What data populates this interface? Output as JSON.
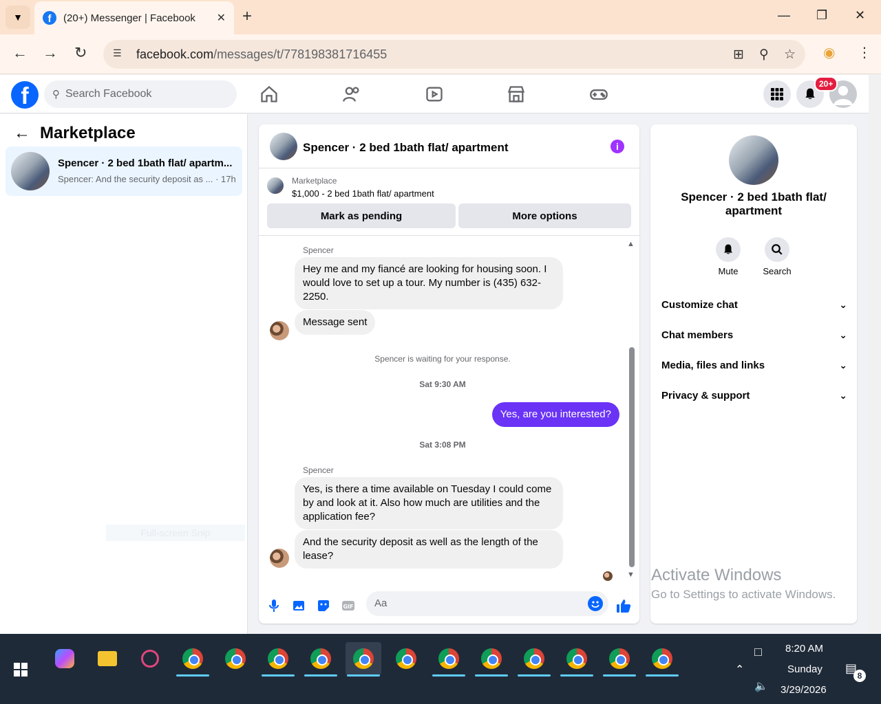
{
  "browser": {
    "tab_title": "(20+) Messenger | Facebook",
    "url_host": "facebook.com",
    "url_path": "/messages/t/778198381716455"
  },
  "fb": {
    "search_placeholder": "Search Facebook",
    "notif_badge": "20+"
  },
  "left": {
    "title": "Marketplace",
    "conversation": {
      "name": "Spencer · 2 bed 1bath flat/ apartm...",
      "preview": "Spencer: And the security deposit as ... · 17h"
    },
    "snip_label": "Full-screen Snip"
  },
  "chat": {
    "header_name": "Spencer · 2 bed 1bath flat/ apartment",
    "marketplace_label": "Marketplace",
    "listing": "$1,000 - 2 bed 1bath flat/ apartment",
    "mark_pending": "Mark as pending",
    "more_options": "More options",
    "messages": {
      "sender1": "Spencer",
      "m1": "Hey me and my fiancé are looking for housing soon.  I would love to set up a tour.  My number is (435) 632-2250.",
      "m2": "Message sent",
      "waiting": "Spencer is waiting for your response.",
      "time1": "Sat 9:30 AM",
      "out1": "Yes, are you interested?",
      "time2": "Sat 3:08 PM",
      "sender2": "Spencer",
      "m3": "Yes, is there a time available on Tuesday I could come by and look at it.  Also how much are utilities and the application fee?",
      "m4": "And the security deposit as well as the length of the lease?"
    },
    "composer_placeholder": "Aa"
  },
  "info": {
    "name": "Spencer · 2 bed 1bath flat/ apartment",
    "mute": "Mute",
    "search": "Search",
    "rows": [
      "Customize chat",
      "Chat members",
      "Media, files and links",
      "Privacy & support"
    ]
  },
  "watermark": {
    "line1": "Activate Windows",
    "line2": "Go to Settings to activate Windows."
  },
  "taskbar": {
    "time": "8:20 AM",
    "day": "Sunday",
    "date": "3/29/2026",
    "notifications": "8"
  },
  "colors": {
    "fb_blue": "#0866ff",
    "outgoing_bubble": "#6a33f6",
    "chrome_tabbar": "#fbe3cf"
  }
}
